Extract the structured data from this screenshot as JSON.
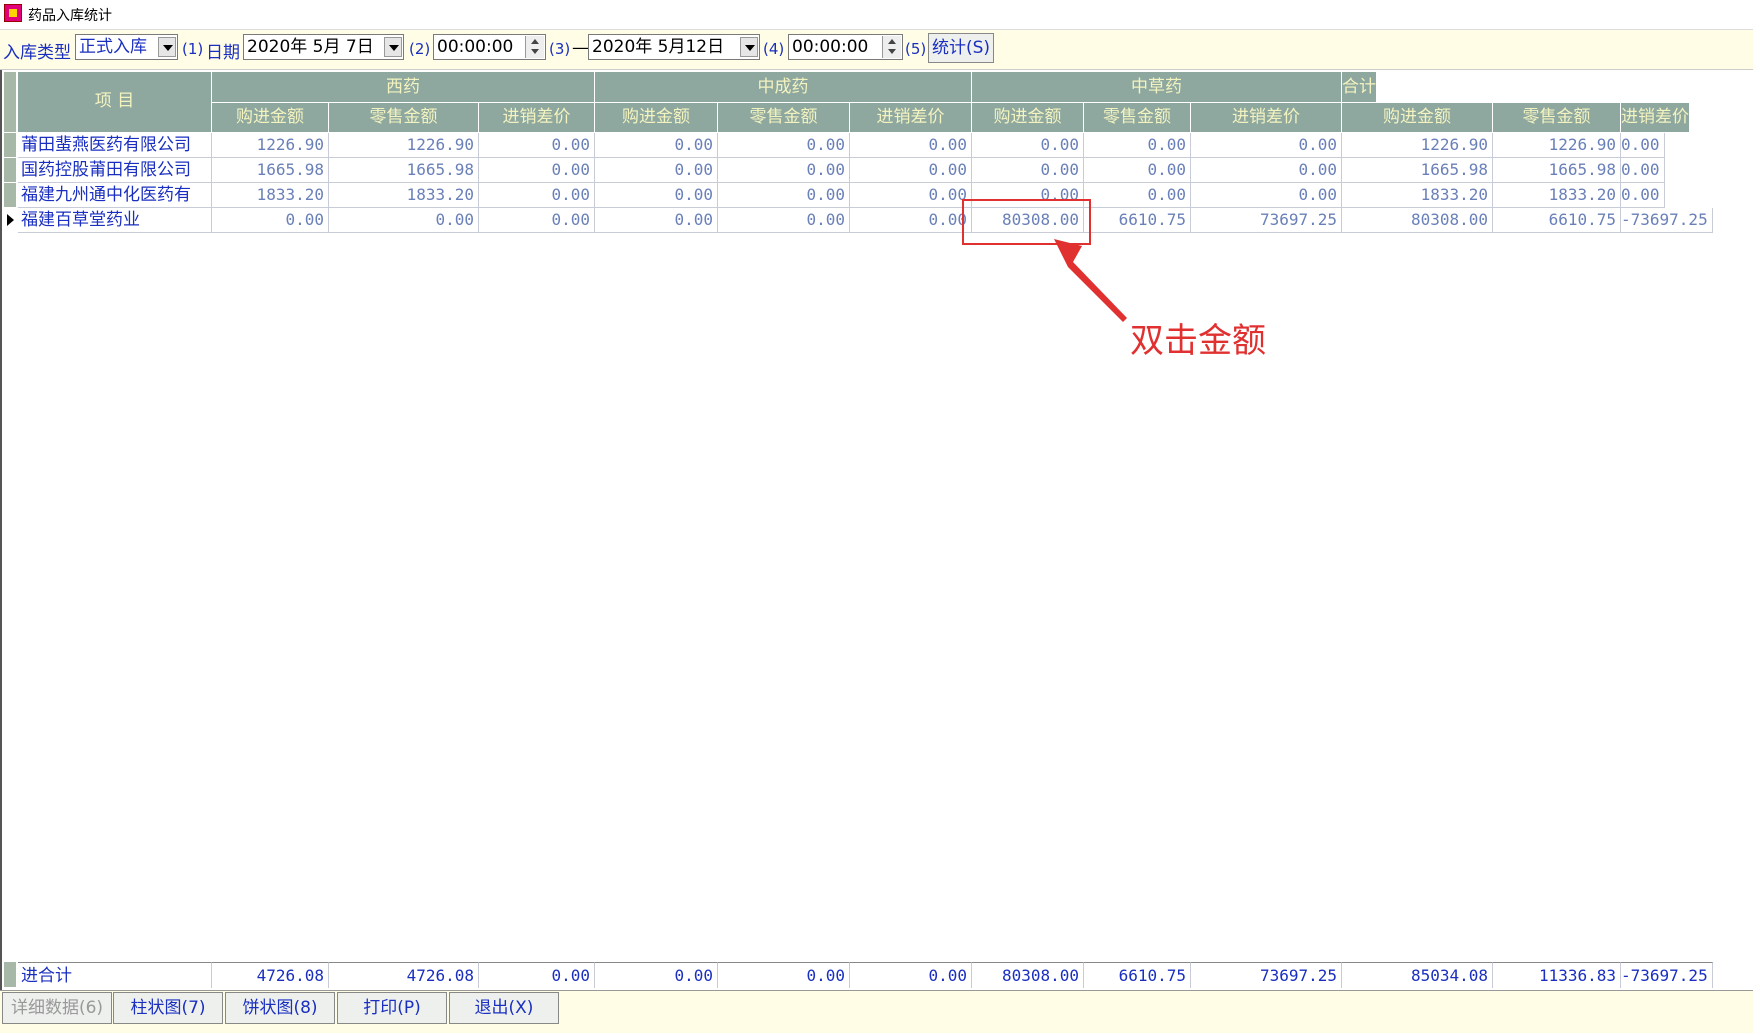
{
  "window": {
    "title": "药品入库统计"
  },
  "toolbar": {
    "type_label": "入库类型",
    "type_value": "正式入库",
    "hint1": "(1)",
    "date_label": "日期",
    "date_from": "2020年 5月 7日",
    "hint2": "(2)",
    "time_from": "00:00:00",
    "hint3": "(3)",
    "dash": "—",
    "date_to": "2020年 5月12日",
    "hint4": "(4)",
    "time_to": "00:00:00",
    "hint5": "(5)",
    "stat_button": "统计(S)"
  },
  "table": {
    "item_header": "项 目",
    "groups": [
      "西药",
      "中成药",
      "中草药",
      "合计"
    ],
    "sub_headers": [
      "购进金额",
      "零售金额",
      "进销差价"
    ],
    "rows": [
      {
        "name": "莆田蜚燕医药有限公司",
        "values": [
          "1226.90",
          "1226.90",
          "0.00",
          "0.00",
          "0.00",
          "0.00",
          "0.00",
          "0.00",
          "0.00",
          "1226.90",
          "1226.90",
          "0.00"
        ]
      },
      {
        "name": "国药控股莆田有限公司",
        "values": [
          "1665.98",
          "1665.98",
          "0.00",
          "0.00",
          "0.00",
          "0.00",
          "0.00",
          "0.00",
          "0.00",
          "1665.98",
          "1665.98",
          "0.00"
        ]
      },
      {
        "name": "福建九州通中化医药有",
        "values": [
          "1833.20",
          "1833.20",
          "0.00",
          "0.00",
          "0.00",
          "0.00",
          "0.00",
          "0.00",
          "0.00",
          "1833.20",
          "1833.20",
          "0.00"
        ]
      },
      {
        "name": "福建百草堂药业",
        "values": [
          "0.00",
          "0.00",
          "0.00",
          "0.00",
          "0.00",
          "0.00",
          "80308.00",
          "6610.75",
          "73697.25",
          "80308.00",
          "6610.75",
          "-73697.25"
        ]
      }
    ],
    "total": {
      "name": "进合计",
      "values": [
        "4726.08",
        "4726.08",
        "0.00",
        "0.00",
        "0.00",
        "0.00",
        "80308.00",
        "6610.75",
        "73697.25",
        "85034.08",
        "11336.83",
        "-73697.25"
      ]
    }
  },
  "bottom": {
    "detail": "详细数据(6)",
    "bar": "柱状图(7)",
    "pie": "饼状图(8)",
    "print": "打印(P)",
    "exit": "退出(X)"
  },
  "annotation": {
    "text": "双击金额",
    "color": "#e03030"
  }
}
